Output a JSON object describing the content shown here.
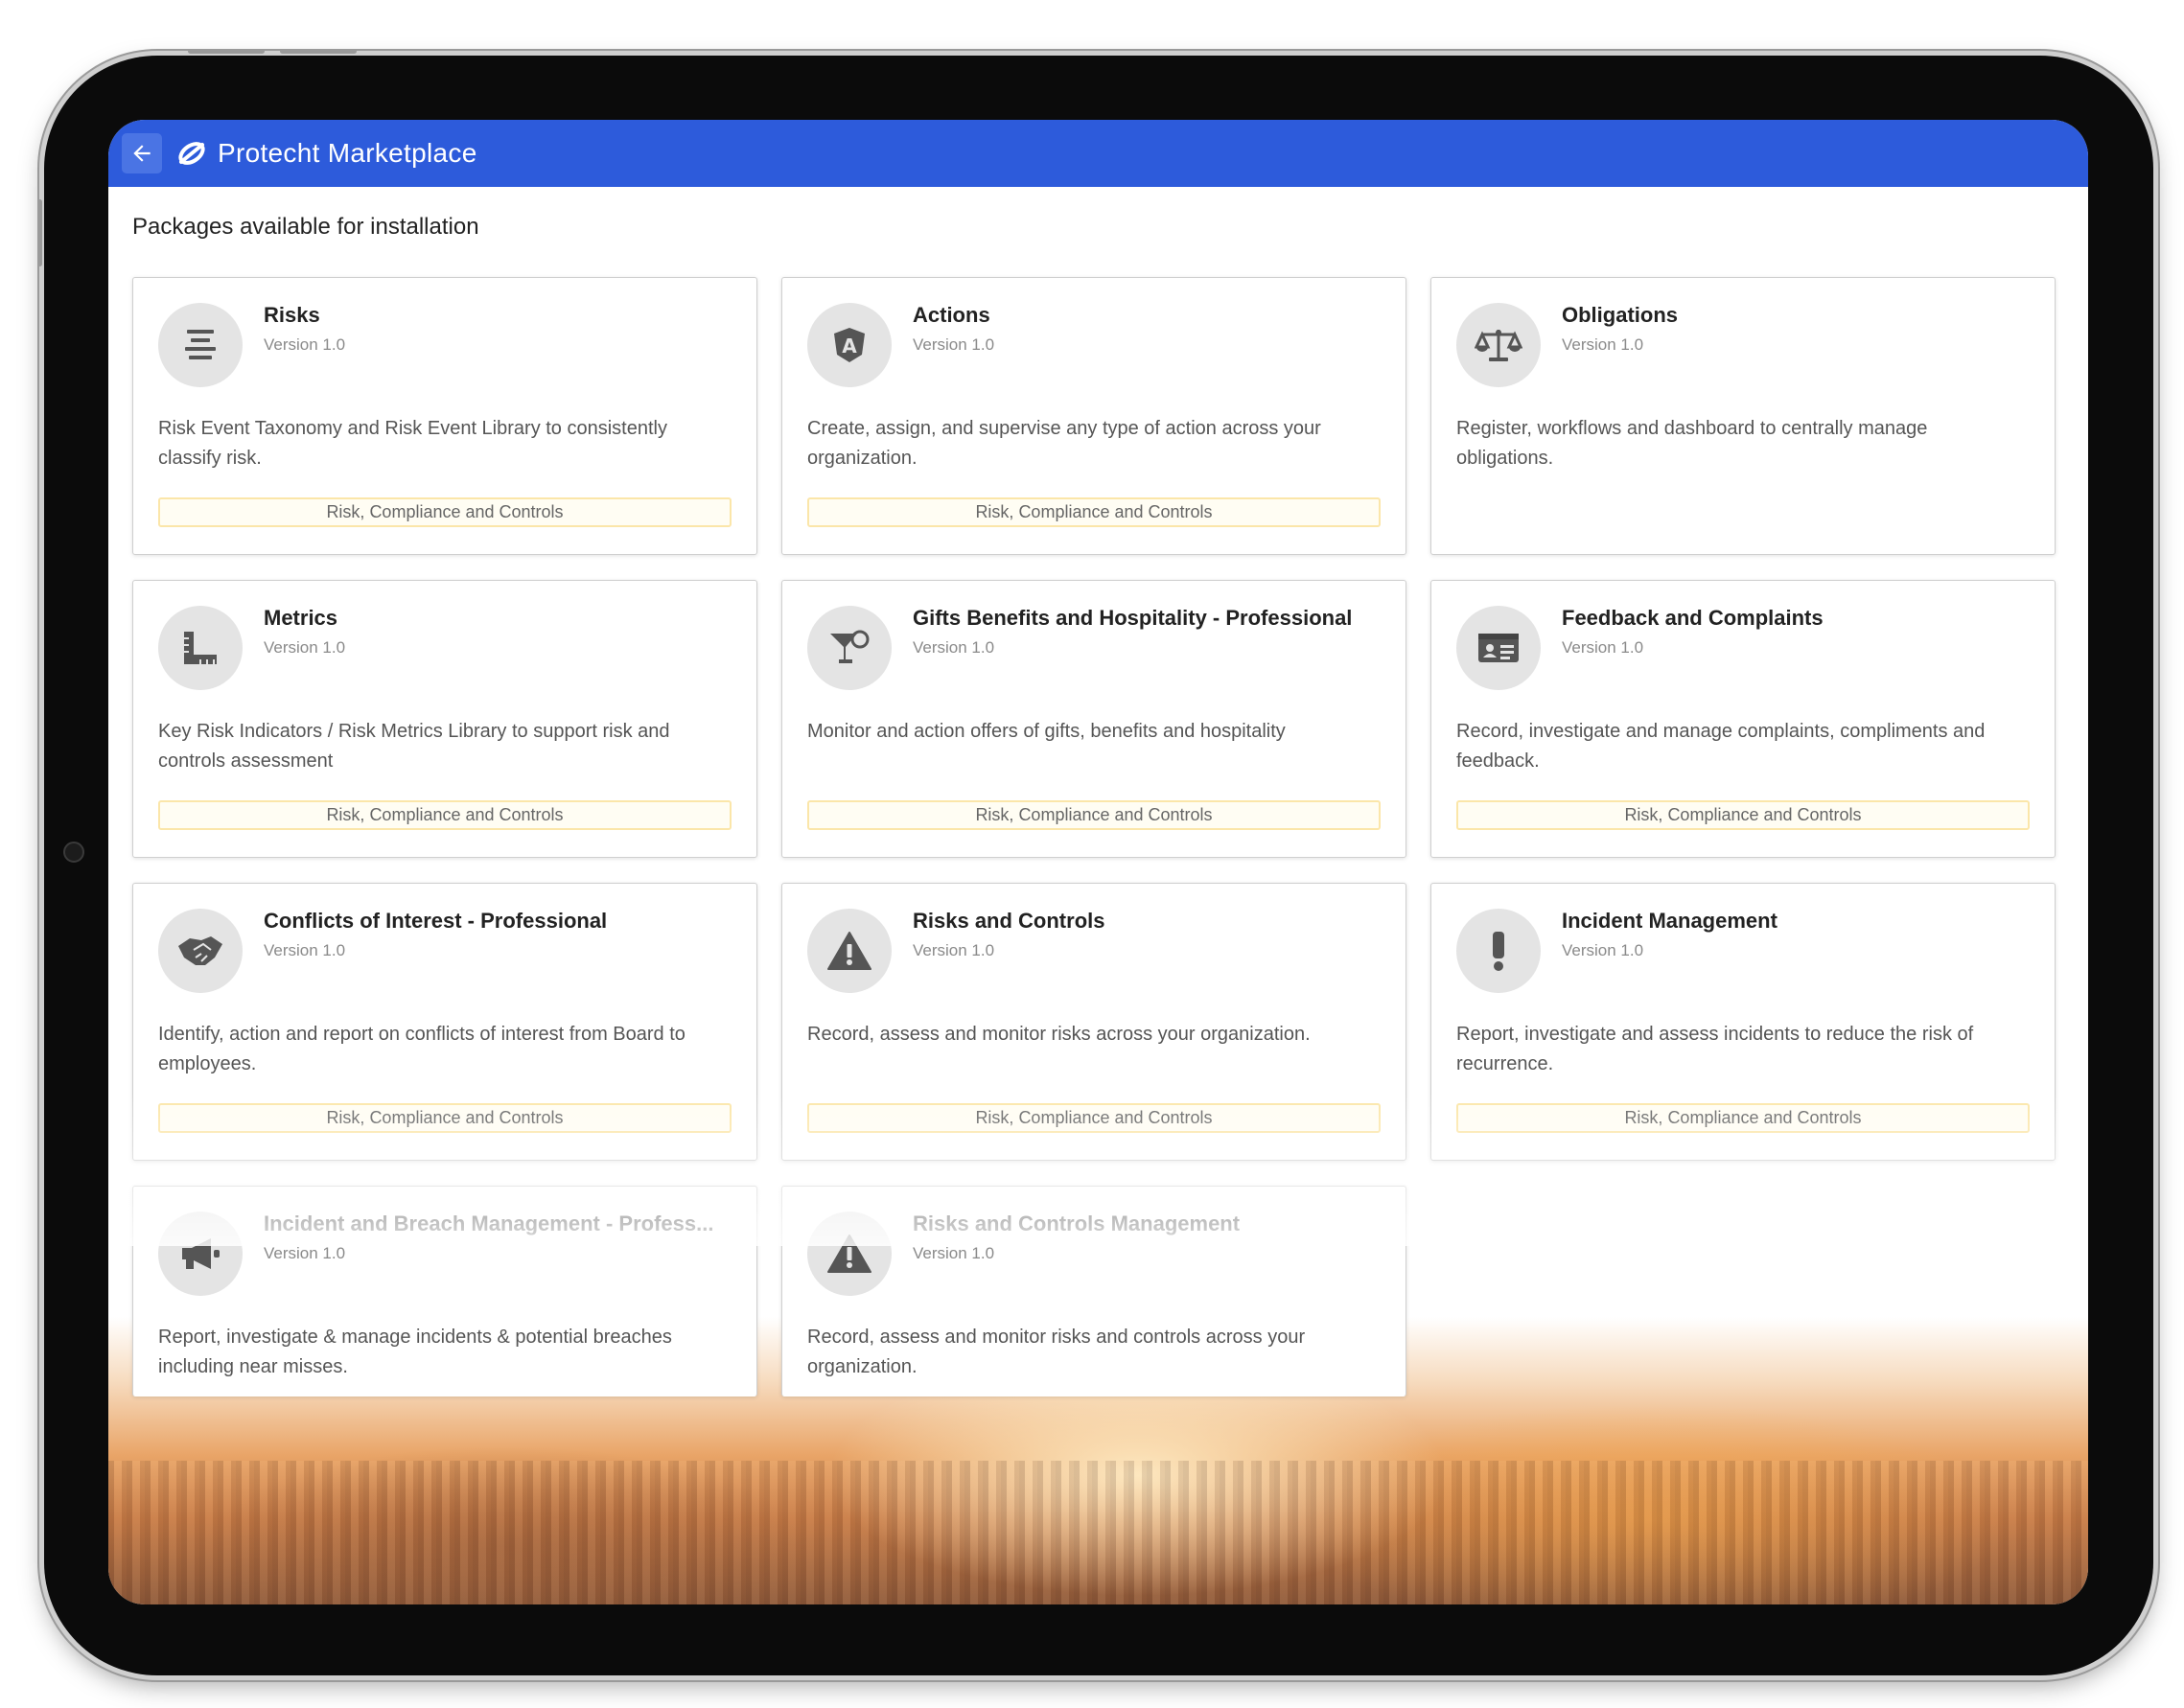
{
  "header": {
    "title": "Protecht Marketplace",
    "back_icon": "arrow-left-icon",
    "logo_icon": "protecht-logo-icon",
    "background_color": "#2d5bdb"
  },
  "main": {
    "heading": "Packages available for installation"
  },
  "cards": [
    {
      "title": "Risks",
      "version": "Version 1.0",
      "description": "Risk Event Taxonomy and Risk Event Library to consistently classify risk.",
      "tag": "Risk, Compliance and Controls",
      "icon": "align-center-icon"
    },
    {
      "title": "Actions",
      "version": "Version 1.0",
      "description": "Create, assign, and supervise any type of action across your organization.",
      "tag": "Risk, Compliance and Controls",
      "icon": "shield-a-icon"
    },
    {
      "title": "Obligations",
      "version": "Version 1.0",
      "description": "Register, workflows and dashboard to centrally manage obligations.",
      "tag": "",
      "icon": "balance-scale-icon"
    },
    {
      "title": "Metrics",
      "version": "Version 1.0",
      "description": "Key Risk Indicators / Risk Metrics Library to support risk and controls assessment",
      "tag": "Risk, Compliance and Controls",
      "icon": "ruler-combined-icon"
    },
    {
      "title": "Gifts Benefits and Hospitality - Professional",
      "version": "Version 1.0",
      "description": "Monitor and action offers of gifts, benefits and hospitality",
      "tag": "Risk, Compliance and Controls",
      "icon": "cocktail-icon"
    },
    {
      "title": "Feedback and Complaints",
      "version": "Version 1.0",
      "description": "Record, investigate and manage complaints, compliments and feedback.",
      "tag": "Risk, Compliance and Controls",
      "icon": "id-card-icon"
    },
    {
      "title": "Conflicts of Interest - Professional",
      "version": "Version 1.0",
      "description": "Identify, action and report on conflicts of interest from Board to employees.",
      "tag": "Risk, Compliance and Controls",
      "icon": "handshake-icon"
    },
    {
      "title": "Risks and Controls",
      "version": "Version 1.0",
      "description": "Record, assess and monitor risks across your organization.",
      "tag": "Risk, Compliance and Controls",
      "icon": "warning-icon"
    },
    {
      "title": "Incident Management",
      "version": "Version 1.0",
      "description": "Report, investigate and assess incidents to reduce the risk of recurrence.",
      "tag": "Risk, Compliance and Controls",
      "icon": "exclamation-icon"
    },
    {
      "title": "Incident and Breach Management - Profess...",
      "version": "Version 1.0",
      "description": "Report, investigate & manage incidents & potential breaches including near misses.",
      "tag": "",
      "icon": "megaphone-icon"
    },
    {
      "title": "Risks and Controls Management",
      "version": "Version 1.0",
      "description": "Record, assess and monitor risks and controls across your organization.",
      "tag": "",
      "icon": "warning-icon"
    }
  ]
}
